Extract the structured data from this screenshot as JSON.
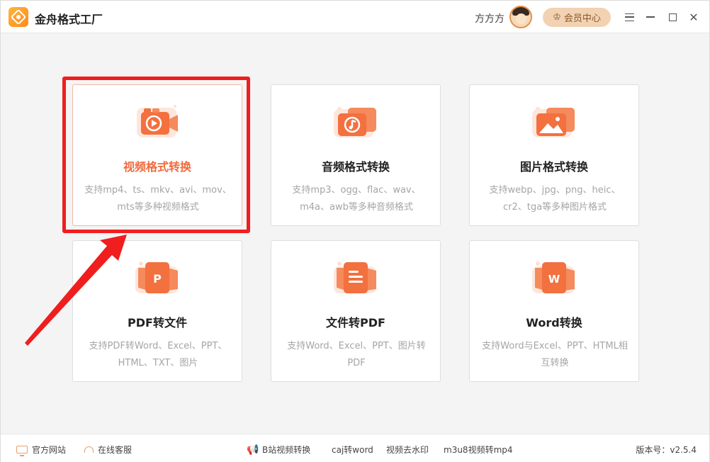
{
  "app": {
    "title": "金舟格式工厂"
  },
  "header": {
    "username": "方方方",
    "vip_label": "会员中心"
  },
  "cards": [
    {
      "title": "视频格式转换",
      "desc": "支持mp4、ts、mkv、avi、mov、mts等多种视频格式",
      "icon": "video-icon"
    },
    {
      "title": "音频格式转换",
      "desc": "支持mp3、ogg、flac、wav、m4a、awb等多种音频格式",
      "icon": "audio-icon"
    },
    {
      "title": "图片格式转换",
      "desc": "支持webp、jpg、png、heic、cr2、tga等多种图片格式",
      "icon": "image-icon"
    },
    {
      "title": "PDF转文件",
      "desc": "支持PDF转Word、Excel、PPT、HTML、TXT、图片",
      "icon": "pdf-icon",
      "badge": "P"
    },
    {
      "title": "文件转PDF",
      "desc": "支持Word、Excel、PPT、图片转PDF",
      "icon": "document-icon"
    },
    {
      "title": "Word转换",
      "desc": "支持Word与Excel、PPT、HTML相互转换",
      "icon": "word-icon",
      "badge": "W"
    }
  ],
  "footer": {
    "website": "官方网站",
    "service": "在线客服",
    "links": [
      "B站视频转换",
      "caj转word",
      "视频去水印",
      "m3u8视频转mp4"
    ],
    "version": "版本号：v2.5.4"
  },
  "colors": {
    "accent": "#ef6b3e",
    "highlight": "#f01e1e",
    "vip_bg": "#f2d2b2"
  }
}
